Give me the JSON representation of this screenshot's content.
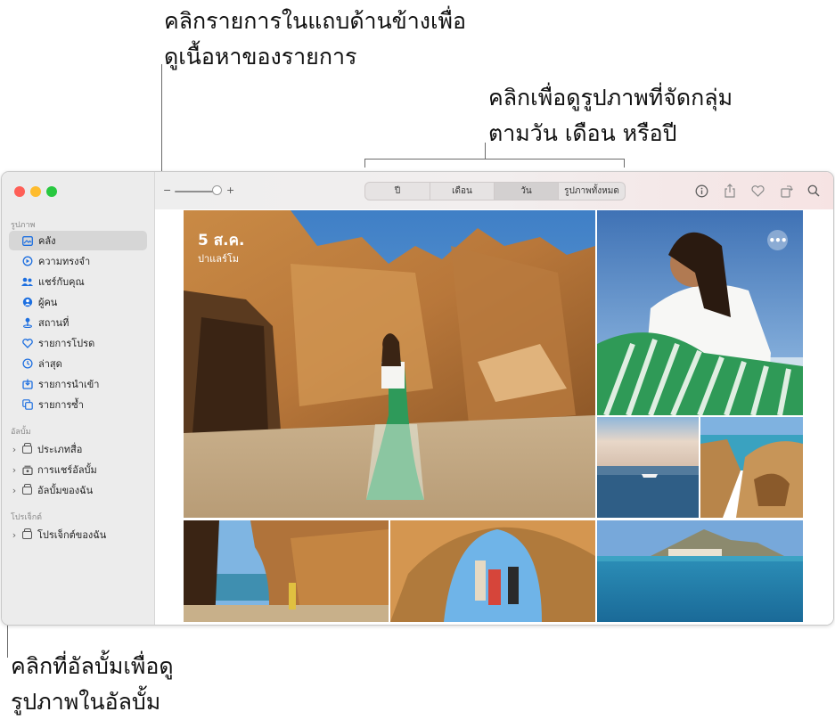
{
  "callouts": {
    "sidebar": [
      "คลิกรายการในแถบด้านข้างเพื่อ",
      "ดูเนื้อหาของรายการ"
    ],
    "grouping": [
      "คลิกเพื่อดูรูปภาพที่จัดกลุ่ม",
      "ตามวัน เดือน หรือปี"
    ],
    "albums": [
      "คลิกที่อัลบั้มเพื่อดู",
      "รูปภาพในอัลบั้ม"
    ]
  },
  "sidebar": {
    "photos_section": "รูปภาพ",
    "items": [
      {
        "label": "คลัง",
        "icon": "library-icon"
      },
      {
        "label": "ความทรงจำ",
        "icon": "memories-icon"
      },
      {
        "label": "แชร์กับคุณ",
        "icon": "shared-with-you-icon"
      },
      {
        "label": "ผู้คน",
        "icon": "people-icon"
      },
      {
        "label": "สถานที่",
        "icon": "places-icon"
      },
      {
        "label": "รายการโปรด",
        "icon": "heart-icon"
      },
      {
        "label": "ล่าสุด",
        "icon": "clock-icon"
      },
      {
        "label": "รายการนำเข้า",
        "icon": "import-icon"
      },
      {
        "label": "รายการซ้ำ",
        "icon": "duplicates-icon"
      }
    ],
    "albums_section": "อัลบั้ม",
    "albums": [
      {
        "label": "ประเภทสื่อ",
        "icon": "folder-icon"
      },
      {
        "label": "การแชร์อัลบั้ม",
        "icon": "shared-album-icon"
      },
      {
        "label": "อัลบั้มของฉัน",
        "icon": "folder-icon"
      }
    ],
    "projects_section": "โปรเจ็กต์",
    "projects": [
      {
        "label": "โปรเจ็กต์ของฉัน",
        "icon": "folder-icon"
      }
    ]
  },
  "toolbar": {
    "zoom_minus": "−",
    "zoom_plus": "+",
    "view_tabs": [
      "ปี",
      "เดือน",
      "วัน",
      "รูปภาพทั้งหมด"
    ],
    "active_tab": "วัน"
  },
  "content": {
    "date": "5 ส.ค.",
    "place": "ปาแลร์โม",
    "more": "•••"
  },
  "colors": {
    "accent": "#1d6fe0",
    "close": "#fe5f57",
    "minimize": "#febc2e",
    "zoom": "#28c840"
  }
}
